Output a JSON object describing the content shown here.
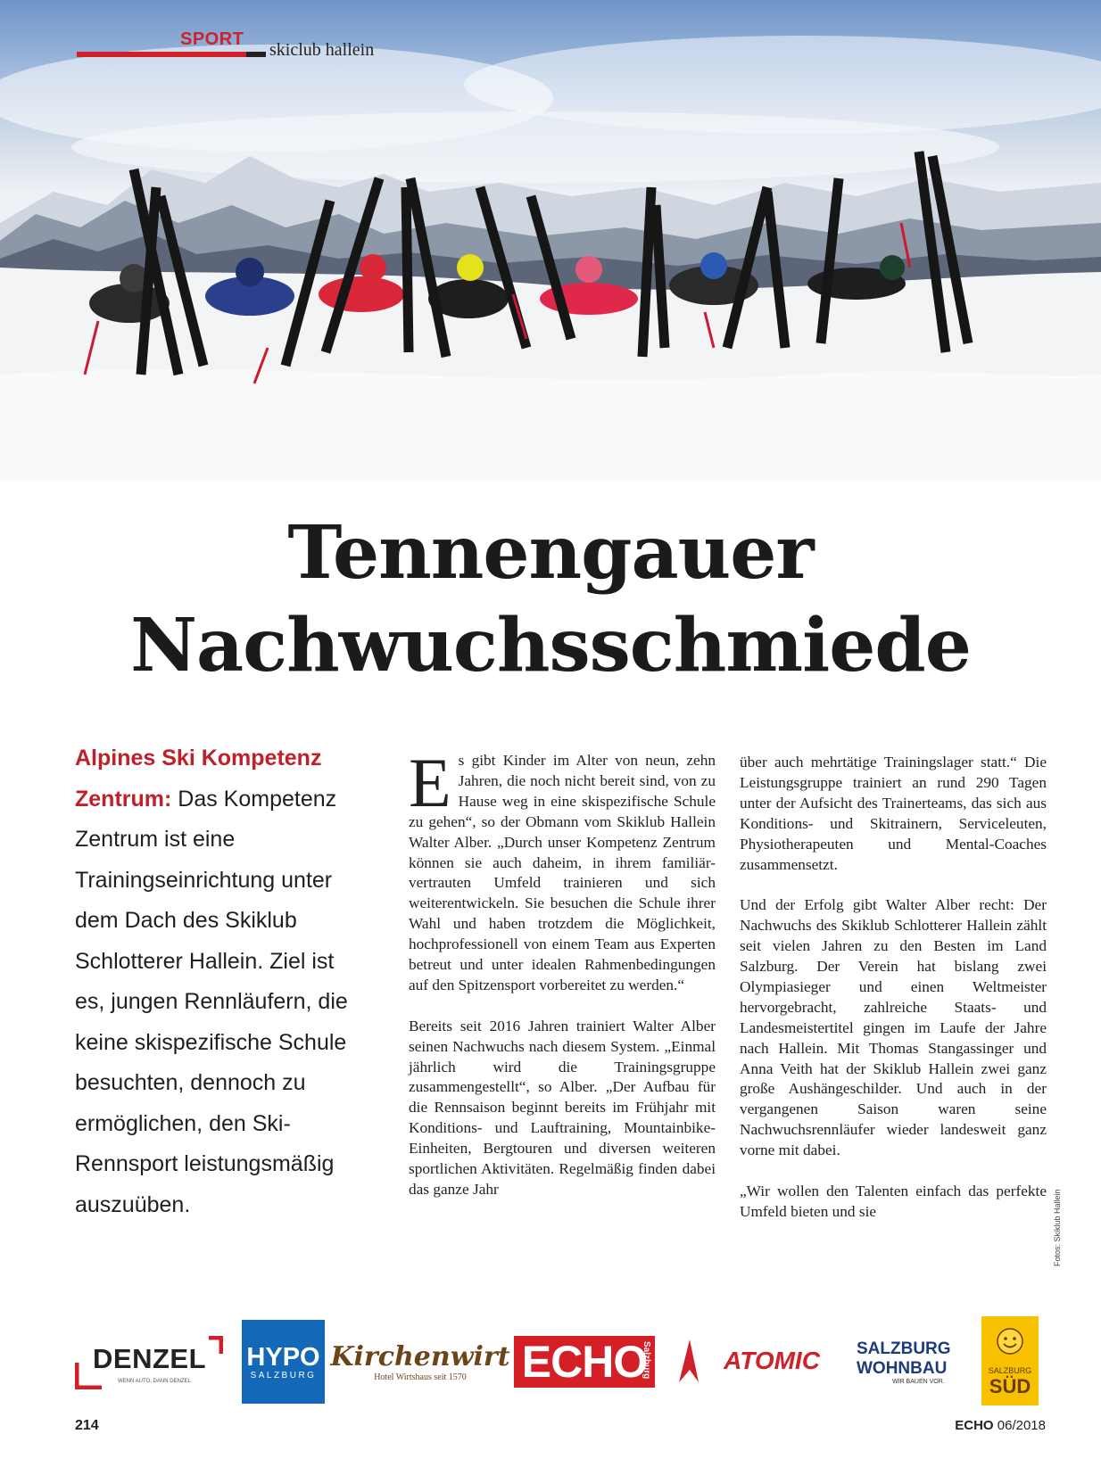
{
  "section": {
    "label": "SPORT",
    "sub": "skiclub hallein"
  },
  "headline": {
    "line1": "Tennengauer",
    "line2": "Nachwuchsschmiede"
  },
  "intro": {
    "lead": "Alpines Ski Kompetenz Zentrum:",
    "text": " Das Kompetenz Zentrum ist eine Trainingseinrichtung unter dem Dach des Skiklub Schlotterer Hallein. Ziel ist es, jungen Rennläufern, die keine skispezifische Schule besuchten, dennoch zu ermöglichen, den Ski-Rennsport leistungsmäßig auszuüben."
  },
  "body": {
    "dropcap": "E",
    "col1_p1": "s gibt Kinder im Alter von neun, zehn Jahren, die noch nicht bereit sind, von zu Hause weg in eine skispezifische Schule zu gehen“, so der Obmann vom Skiklub Hallein Walter Alber. „Durch unser Kompetenz Zentrum können sie auch daheim, in ihrem familiär-vertrauten Umfeld trainieren und sich weiterentwickeln. Sie besuchen die Schule ihrer Wahl und haben trotzdem die Möglichkeit, hochprofessionell von einem Team aus Experten betreut und unter idealen Rahmenbedingungen auf den Spitzensport vorbereitet zu werden.“",
    "col1_p2": "Bereits seit 2016 Jahren trainiert Walter Alber seinen Nachwuchs nach diesem System. „Einmal jährlich wird die Trainingsgruppe zusammengestellt“, so Alber. „Der Aufbau für die Rennsaison beginnt bereits im Frühjahr mit Konditions- und Lauftraining, Mountainbike-Einheiten, Bergtouren und diversen weiteren sportlichen Aktivitäten. Regelmäßig finden dabei das ganze Jahr",
    "col2_p1": "über auch mehrtätige Trainingslager statt.“ Die Leistungsgruppe trainiert an rund 290 Tagen unter der Aufsicht des Trainerteams, das sich aus Konditions- und Skitrainern, Serviceleuten, Physiotherapeuten und Mental-Coaches zusammensetzt.",
    "col2_p2": "Und der Erfolg gibt Walter Alber recht: Der Nachwuchs des Skiklub Schlotterer Hallein zählt seit vielen Jahren zu den Besten im Land Salzburg. Der Verein hat bislang zwei Olympiasieger und einen Weltmeister hervorgebracht, zahlreiche Staats- und Landesmeistertitel gingen im Laufe der Jahre nach Hallein. Mit Thomas Stangassinger und Anna Veith hat der Skiklub Hallein zwei ganz große Aushängeschilder. Und auch in der vergangenen Saison waren seine Nachwuchsrennläufer wieder landesweit ganz vorne mit dabei.",
    "col2_p3": "„Wir wollen den Talenten einfach das perfekte Umfeld bieten und sie"
  },
  "photo_credit": "Fotos: Skiklub Hallein",
  "sponsors": {
    "denzel": {
      "name": "DENZEL",
      "tagline": "WENN AUTO, DANN DENZEL"
    },
    "hypo": {
      "name": "HYPO",
      "sub": "SALZBURG"
    },
    "kirchenwirt": {
      "name": "Kirchenwirt",
      "sub": "Hotel   Wirtshaus seit 1570"
    },
    "echo": {
      "name": "ECHO",
      "sub": "Salzburg"
    },
    "atomic": {
      "name": "ATOMIC"
    },
    "wohnbau": {
      "line1": "SALZBURG",
      "line2": "WOHNBAU",
      "tagline": "WIR BAUEN VOR."
    },
    "sued": {
      "top": "SALZBURG",
      "name": "SÜD"
    }
  },
  "footer": {
    "page": "214",
    "magazine": "ECHO",
    "issue": "06/2018"
  },
  "colors": {
    "accent_red": "#d0202a",
    "hypo_blue": "#1468b8",
    "echo_red": "#d51f26"
  }
}
